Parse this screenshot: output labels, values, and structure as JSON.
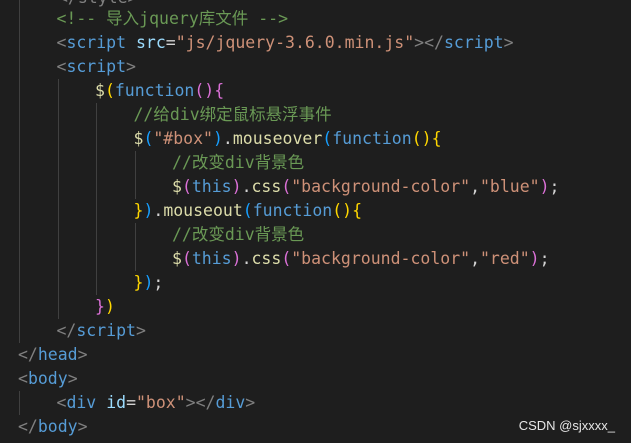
{
  "editor": {
    "theme_background": "#1e1e1e",
    "top_partial": "</style>",
    "lines": [
      {
        "indent": 1,
        "tokens": [
          {
            "t": "<!-- 导入jquery库文件 -->",
            "c": "comment"
          }
        ]
      },
      {
        "indent": 1,
        "tokens": [
          {
            "t": "<",
            "c": "punct"
          },
          {
            "t": "script",
            "c": "tag"
          },
          {
            "t": " ",
            "c": "plain"
          },
          {
            "t": "src",
            "c": "attr"
          },
          {
            "t": "=",
            "c": "plain"
          },
          {
            "t": "\"js/jquery-3.6.0.min.js\"",
            "c": "str"
          },
          {
            "t": "></",
            "c": "punct"
          },
          {
            "t": "script",
            "c": "tag"
          },
          {
            "t": ">",
            "c": "punct"
          }
        ]
      },
      {
        "indent": 1,
        "tokens": [
          {
            "t": "<",
            "c": "punct"
          },
          {
            "t": "script",
            "c": "tag"
          },
          {
            "t": ">",
            "c": "punct"
          }
        ]
      },
      {
        "indent": 2,
        "tokens": [
          {
            "t": "$",
            "c": "fn"
          },
          {
            "t": "(",
            "c": "br1"
          },
          {
            "t": "function",
            "c": "kw"
          },
          {
            "t": "()",
            "c": "br2"
          },
          {
            "t": "{",
            "c": "br2"
          }
        ]
      },
      {
        "indent": 3,
        "tokens": [
          {
            "t": "//给div绑定鼠标悬浮事件",
            "c": "comment"
          }
        ]
      },
      {
        "indent": 3,
        "tokens": [
          {
            "t": "$",
            "c": "fn"
          },
          {
            "t": "(",
            "c": "br3"
          },
          {
            "t": "\"#box\"",
            "c": "str"
          },
          {
            "t": ")",
            "c": "br3"
          },
          {
            "t": ".",
            "c": "plain"
          },
          {
            "t": "mouseover",
            "c": "fn"
          },
          {
            "t": "(",
            "c": "br3"
          },
          {
            "t": "function",
            "c": "kw"
          },
          {
            "t": "()",
            "c": "br1"
          },
          {
            "t": "{",
            "c": "br1"
          }
        ]
      },
      {
        "indent": 4,
        "tokens": [
          {
            "t": "//改变div背景色",
            "c": "comment"
          }
        ]
      },
      {
        "indent": 4,
        "tokens": [
          {
            "t": "$",
            "c": "fn"
          },
          {
            "t": "(",
            "c": "br2"
          },
          {
            "t": "this",
            "c": "kw"
          },
          {
            "t": ")",
            "c": "br2"
          },
          {
            "t": ".",
            "c": "plain"
          },
          {
            "t": "css",
            "c": "fn"
          },
          {
            "t": "(",
            "c": "br2"
          },
          {
            "t": "\"background-color\"",
            "c": "str"
          },
          {
            "t": ",",
            "c": "plain"
          },
          {
            "t": "\"blue\"",
            "c": "str"
          },
          {
            "t": ")",
            "c": "br2"
          },
          {
            "t": ";",
            "c": "plain"
          }
        ]
      },
      {
        "indent": 3,
        "tokens": [
          {
            "t": "}",
            "c": "br1"
          },
          {
            "t": ")",
            "c": "br3"
          },
          {
            "t": ".",
            "c": "plain"
          },
          {
            "t": "mouseout",
            "c": "fn"
          },
          {
            "t": "(",
            "c": "br3"
          },
          {
            "t": "function",
            "c": "kw"
          },
          {
            "t": "()",
            "c": "br1"
          },
          {
            "t": "{",
            "c": "br1"
          }
        ]
      },
      {
        "indent": 4,
        "tokens": [
          {
            "t": "//改变div背景色",
            "c": "comment"
          }
        ]
      },
      {
        "indent": 4,
        "tokens": [
          {
            "t": "$",
            "c": "fn"
          },
          {
            "t": "(",
            "c": "br2"
          },
          {
            "t": "this",
            "c": "kw"
          },
          {
            "t": ")",
            "c": "br2"
          },
          {
            "t": ".",
            "c": "plain"
          },
          {
            "t": "css",
            "c": "fn"
          },
          {
            "t": "(",
            "c": "br2"
          },
          {
            "t": "\"background-color\"",
            "c": "str"
          },
          {
            "t": ",",
            "c": "plain"
          },
          {
            "t": "\"red\"",
            "c": "str"
          },
          {
            "t": ")",
            "c": "br2"
          },
          {
            "t": ";",
            "c": "plain"
          }
        ]
      },
      {
        "indent": 3,
        "tokens": [
          {
            "t": "}",
            "c": "br1"
          },
          {
            "t": ")",
            "c": "br3"
          },
          {
            "t": ";",
            "c": "plain"
          }
        ]
      },
      {
        "indent": 2,
        "tokens": [
          {
            "t": "}",
            "c": "br2"
          },
          {
            "t": ")",
            "c": "br1"
          }
        ]
      },
      {
        "indent": 1,
        "tokens": [
          {
            "t": "</",
            "c": "punct"
          },
          {
            "t": "script",
            "c": "tag"
          },
          {
            "t": ">",
            "c": "punct"
          }
        ]
      },
      {
        "indent": 0,
        "tokens": [
          {
            "t": "</",
            "c": "punct"
          },
          {
            "t": "head",
            "c": "tag"
          },
          {
            "t": ">",
            "c": "punct"
          }
        ]
      },
      {
        "indent": 0,
        "tokens": [
          {
            "t": "<",
            "c": "punct"
          },
          {
            "t": "body",
            "c": "tag"
          },
          {
            "t": ">",
            "c": "punct"
          }
        ]
      },
      {
        "indent": 1,
        "tokens": [
          {
            "t": "<",
            "c": "punct"
          },
          {
            "t": "div",
            "c": "tag"
          },
          {
            "t": " ",
            "c": "plain"
          },
          {
            "t": "id",
            "c": "attr"
          },
          {
            "t": "=",
            "c": "plain"
          },
          {
            "t": "\"box\"",
            "c": "str"
          },
          {
            "t": "></",
            "c": "punct"
          },
          {
            "t": "div",
            "c": "tag"
          },
          {
            "t": ">",
            "c": "punct"
          }
        ]
      },
      {
        "indent": 0,
        "tokens": [
          {
            "t": "</",
            "c": "punct"
          },
          {
            "t": "body",
            "c": "tag"
          },
          {
            "t": ">",
            "c": "punct"
          }
        ]
      }
    ]
  },
  "watermark": "CSDN @sjxxxx_"
}
